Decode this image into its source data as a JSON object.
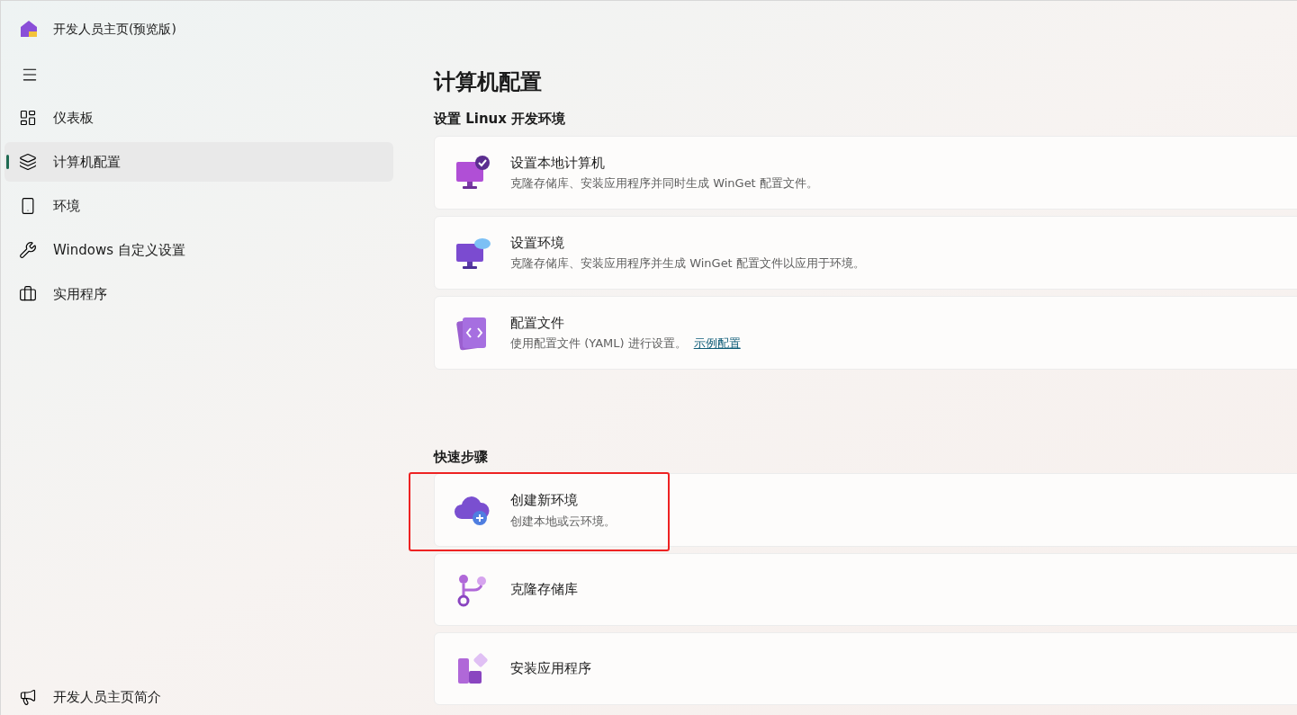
{
  "window": {
    "title": "开发人员主页(预览版)"
  },
  "sidebar": {
    "items": [
      {
        "label": "仪表板",
        "selected": false
      },
      {
        "label": "计算机配置",
        "selected": true
      },
      {
        "label": "环境",
        "selected": false
      },
      {
        "label": "Windows 自定义设置",
        "selected": false
      },
      {
        "label": "实用程序",
        "selected": false
      }
    ],
    "footer_item": {
      "label": "开发人员主页简介"
    }
  },
  "page": {
    "title": "计算机配置",
    "sections": [
      {
        "heading": "设置 Linux 开发环境",
        "cards": [
          {
            "title": "设置本地计算机",
            "description": "克隆存储库、安装应用程序并同时生成 WinGet 配置文件。",
            "highlighted": false
          },
          {
            "title": "设置环境",
            "description": "克隆存储库、安装应用程序并生成 WinGet 配置文件以应用于环境。",
            "highlighted": false
          },
          {
            "title": "配置文件",
            "description": "使用配置文件 (YAML) 进行设置。",
            "link": "示例配置",
            "highlighted": false
          }
        ]
      },
      {
        "heading": "快速步骤",
        "cards": [
          {
            "title": "创建新环境",
            "description": "创建本地或云环境。",
            "highlighted": true
          },
          {
            "title": "克隆存储库",
            "highlighted": false
          },
          {
            "title": "安装应用程序",
            "highlighted": false
          }
        ]
      }
    ]
  }
}
